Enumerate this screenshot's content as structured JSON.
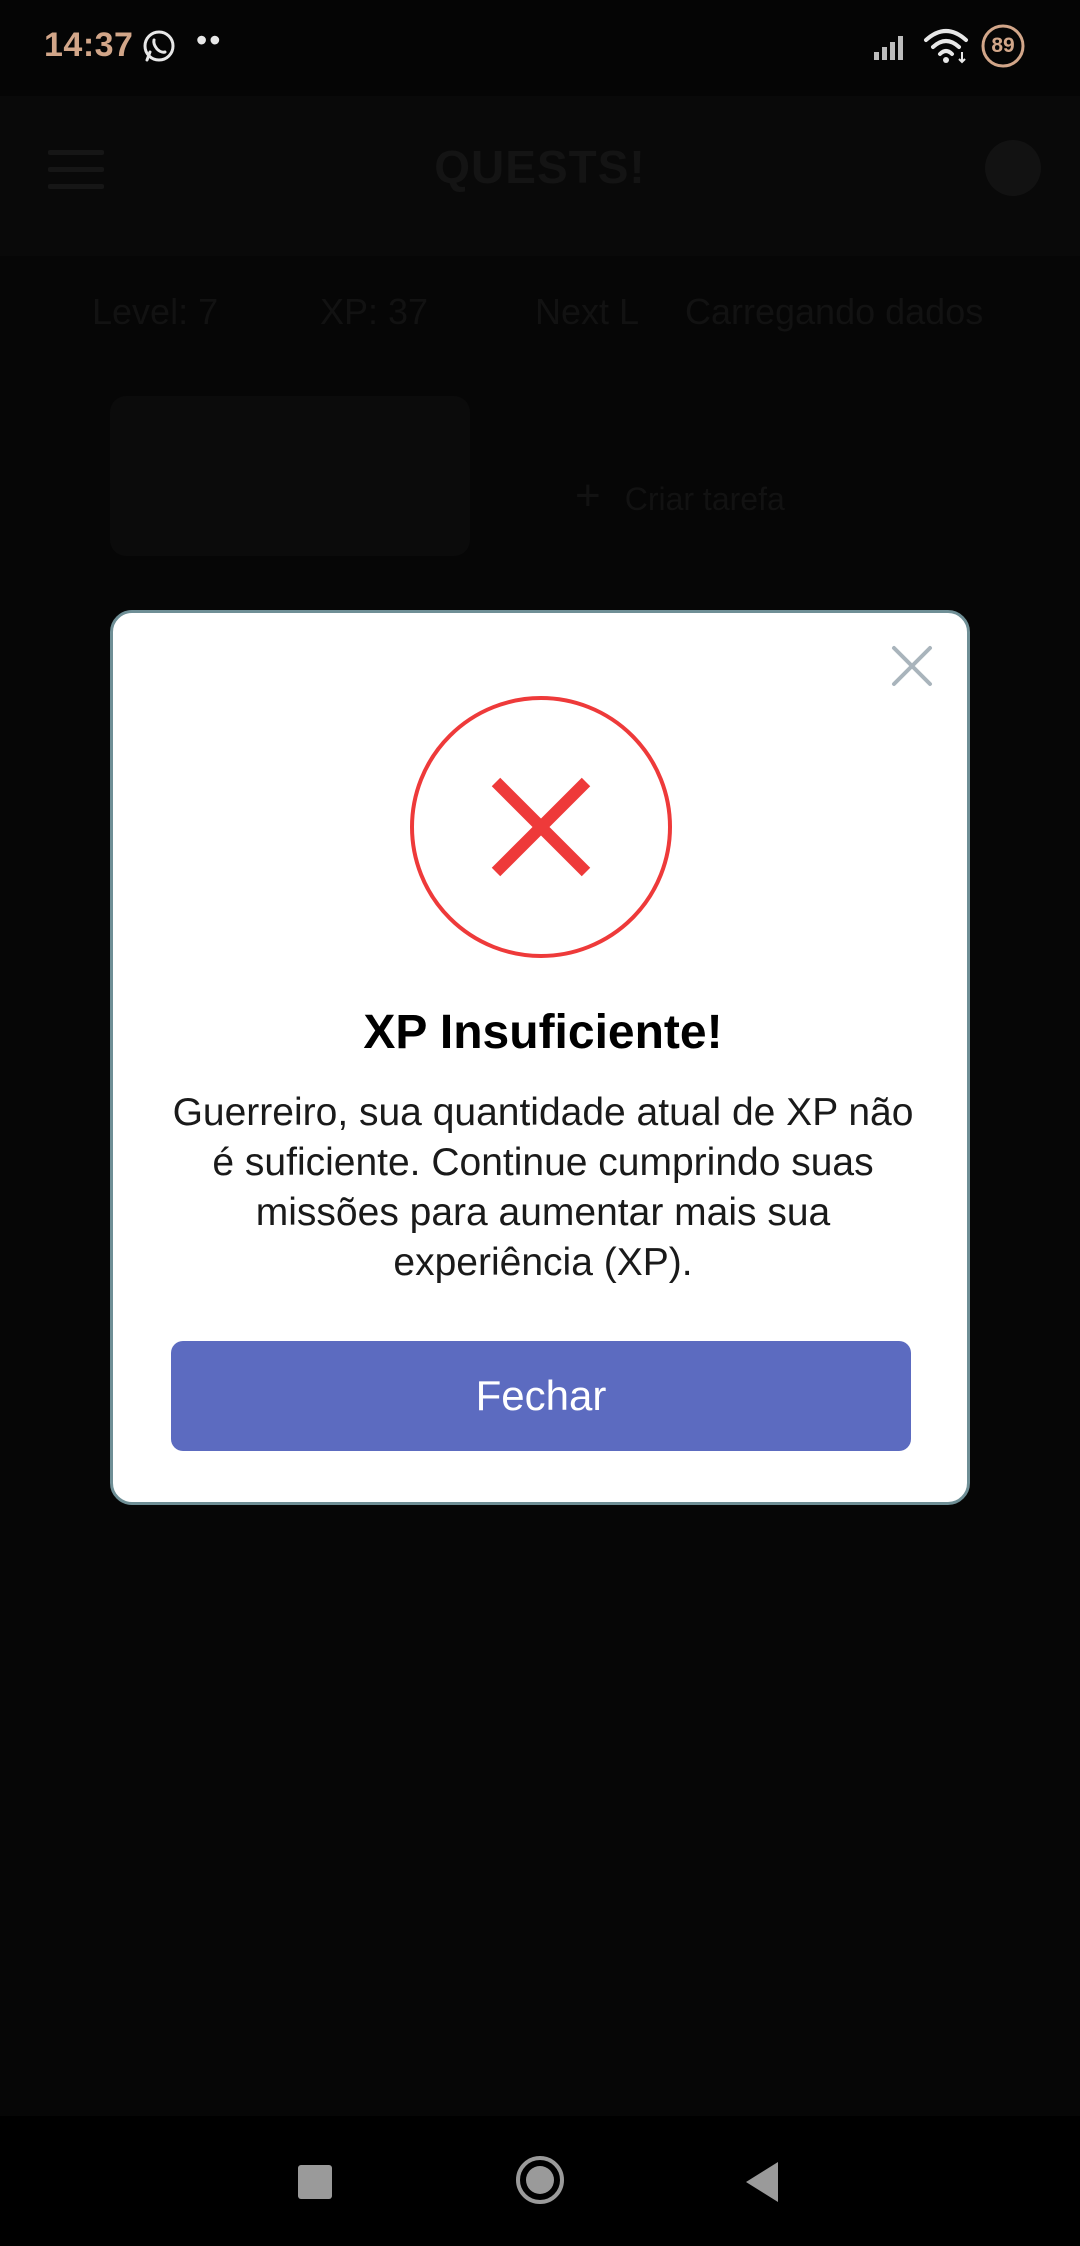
{
  "status_bar": {
    "time": "14:37",
    "dots": "••",
    "battery": "89"
  },
  "app": {
    "title": "QUESTS!",
    "stats": {
      "level": "Level: 7",
      "xp": "XP: 37",
      "next": "Next L",
      "loading": "Carregando dados"
    },
    "add_label": "Criar tarefa"
  },
  "dialog": {
    "title": "XP Insuficiente!",
    "message": "Guerreiro, sua quantidade atual de XP não é suficiente. Continue cumprindo suas missões para aumentar mais sua experiência (XP).",
    "close_button_label": "Fechar",
    "accent_color": "#ee3a3a",
    "button_color": "#5c6bc0"
  }
}
